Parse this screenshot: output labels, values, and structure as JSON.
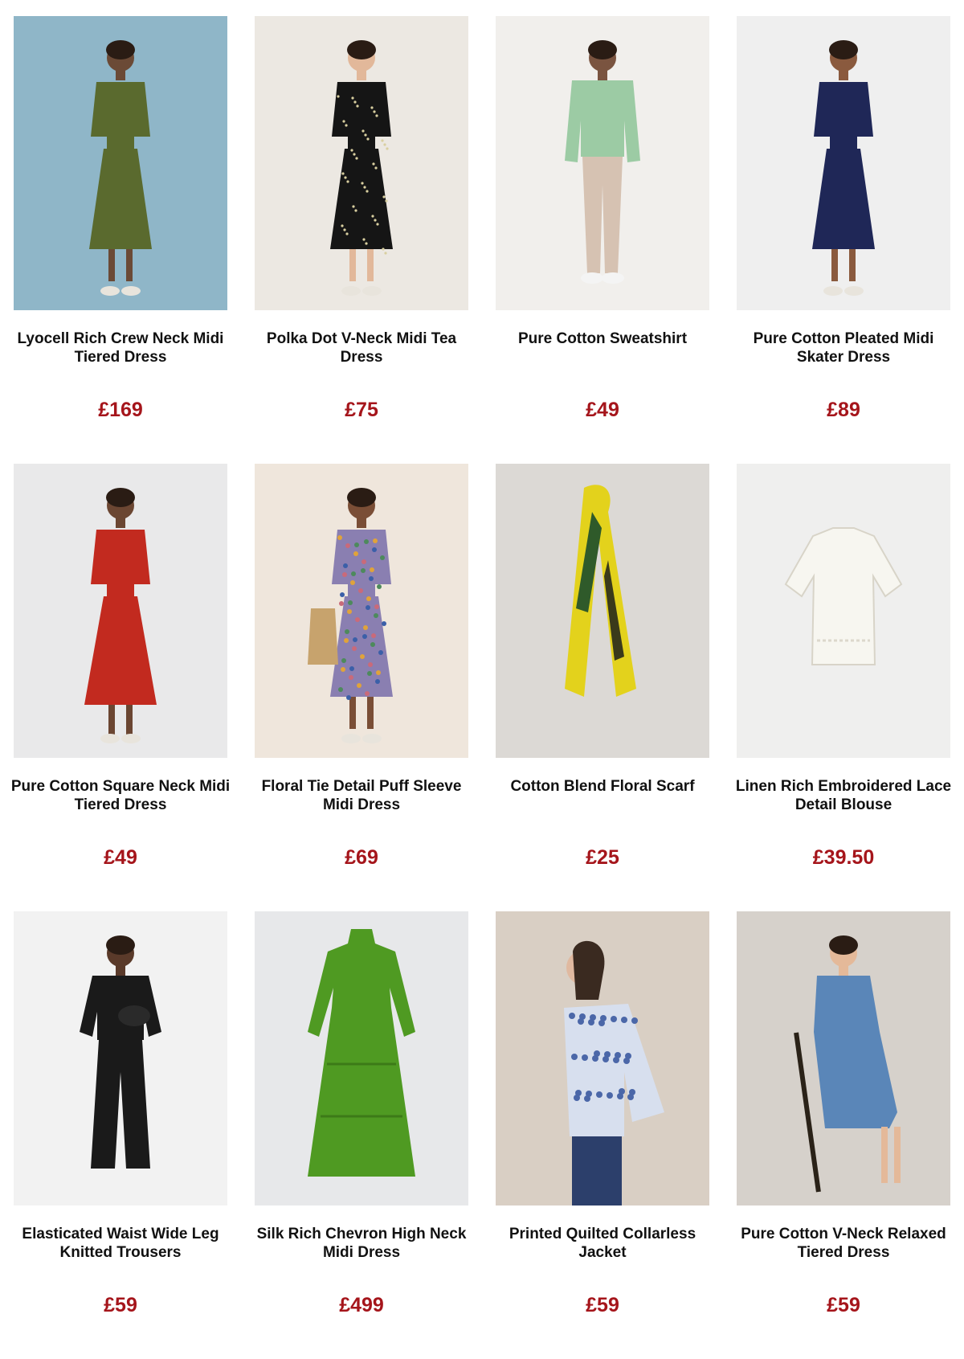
{
  "colors": {
    "price": "#a5151b",
    "title": "#111111"
  },
  "products": [
    {
      "title": "Lyocell Rich Crew Neck Midi Tiered Dress",
      "price": "£169",
      "image": "olive-tiered-dress-photo",
      "bg": "#8fb6c8",
      "main": "#5a6a2e",
      "skin": "#6b4a36",
      "legs": "#6b4a36",
      "kind": "dress"
    },
    {
      "title": "Polka Dot V-Neck Midi Tea Dress",
      "price": "£75",
      "image": "black-polka-dot-dress-photo",
      "bg": "#ece8e2",
      "main": "#151515",
      "skin": "#e2b89a",
      "legs": "#e2b89a",
      "kind": "dress-dots"
    },
    {
      "title": "Pure Cotton Sweatshirt",
      "price": "£49",
      "image": "mint-sweatshirt-photo",
      "bg": "#f1efec",
      "main": "#9ccba4",
      "skin": "#7a5440",
      "legs": "#d6c2b2",
      "kind": "top-trousers"
    },
    {
      "title": "Pure Cotton Pleated Midi Skater Dress",
      "price": "£89",
      "image": "navy-skater-dress-photo",
      "bg": "#efefef",
      "main": "#1f2757",
      "skin": "#8a5a3e",
      "legs": "#8a5a3e",
      "kind": "dress"
    },
    {
      "title": "Pure Cotton Square Neck Midi Tiered Dress",
      "price": "£49",
      "image": "red-tiered-dress-photo",
      "bg": "#e9e9ea",
      "main": "#c22a1f",
      "skin": "#6b4632",
      "legs": "#6b4632",
      "kind": "dress-long"
    },
    {
      "title": "Floral Tie Detail Puff Sleeve Midi Dress",
      "price": "£69",
      "image": "floral-puff-sleeve-dress-photo",
      "bg": "#efe6dc",
      "main": "#8a7fb1",
      "skin": "#7a4e36",
      "legs": "#7a4e36",
      "kind": "dress-floral"
    },
    {
      "title": "Cotton Blend Floral Scarf",
      "price": "£25",
      "image": "floral-scarf-photo",
      "bg": "#dcd9d5",
      "main": "#e3d21c",
      "skin": "#2f5a2a",
      "legs": "#3a3a1a",
      "kind": "scarf"
    },
    {
      "title": "Linen Rich Embroidered Lace Detail Blouse",
      "price": "£39.50",
      "image": "white-lace-blouse-photo",
      "bg": "#efefee",
      "main": "#f7f6f0",
      "skin": "#dcd8cc",
      "legs": "#dcd8cc",
      "kind": "blouse"
    },
    {
      "title": "Elasticated Waist Wide Leg Knitted Trousers",
      "price": "£59",
      "image": "black-knitted-trousers-photo",
      "bg": "#f2f2f2",
      "main": "#1a1a1a",
      "skin": "#5a3a2a",
      "legs": "#1a1a1a",
      "kind": "top-trousers-wide"
    },
    {
      "title": "Silk Rich Chevron High Neck Midi Dress",
      "price": "£499",
      "image": "green-chevron-dress-photo",
      "bg": "#e7e8ea",
      "main": "#4f9a22",
      "skin": "#4f9a22",
      "legs": "#4f9a22",
      "kind": "dress-flat"
    },
    {
      "title": "Printed Quilted Collarless Jacket",
      "price": "£59",
      "image": "printed-quilted-jacket-photo",
      "bg": "#d9cfc4",
      "main": "#d7dfee",
      "skin": "#e0b9a0",
      "legs": "#2c3f6b",
      "kind": "jacket"
    },
    {
      "title": "Pure Cotton V-Neck Relaxed Tiered Dress",
      "price": "£59",
      "image": "denim-blue-tiered-dress-photo",
      "bg": "#d6d1cb",
      "main": "#5a86b8",
      "skin": "#e4b999",
      "legs": "#e4b999",
      "kind": "dress-seated"
    }
  ]
}
